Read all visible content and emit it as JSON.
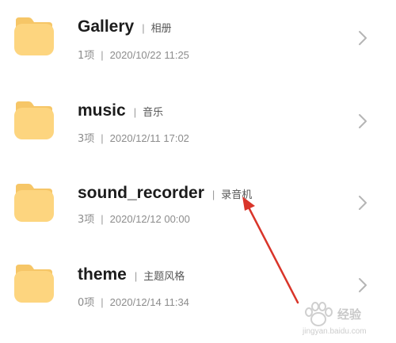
{
  "colors": {
    "folder": "#fdd57f",
    "folder_dark": "#f6c667",
    "annotation_arrow": "#d9352a",
    "chevron": "#b5b5b5"
  },
  "folders": [
    {
      "name": "Gallery",
      "alias": "相册",
      "count": "1项",
      "date": "2020/10/22 11:25",
      "icon": "folder-icon"
    },
    {
      "name": "music",
      "alias": "音乐",
      "count": "3项",
      "date": "2020/12/11 17:02",
      "icon": "folder-icon"
    },
    {
      "name": "sound_recorder",
      "alias": "录音机",
      "count": "3项",
      "date": "2020/12/12 00:00",
      "icon": "folder-icon"
    },
    {
      "name": "theme",
      "alias": "主题风格",
      "count": "0项",
      "date": "2020/12/14 11:34",
      "icon": "folder-icon"
    }
  ],
  "separator": "|",
  "watermark": {
    "text": "经验",
    "url": "jingyan.baidu.com"
  }
}
